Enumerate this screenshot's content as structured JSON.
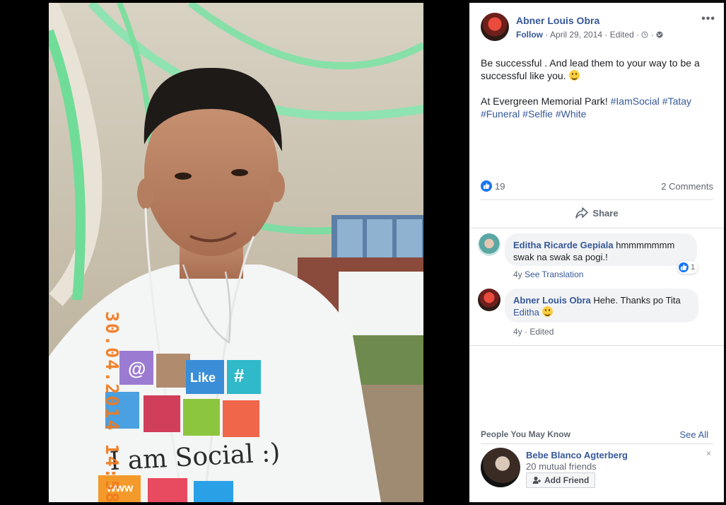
{
  "photo": {
    "date_stamp": "30.04.2014 14:58",
    "shirt_text": "I am Social :)",
    "shirt_like": "Like",
    "shirt_web": "www",
    "shirt_at": "@",
    "shirt_hash": "#"
  },
  "post": {
    "author": "Abner Louis Obra",
    "follow_label": "Follow",
    "separator": "·",
    "date": "April 29, 2014",
    "edited": "Edited",
    "more_label": "•••",
    "text_line1": "Be successful . And lead them to your way to be a successful like you.",
    "location_prefix": "At Evergreen Memorial Park!",
    "hashtags": [
      "#IamSocial",
      "#Tatay",
      "#Funeral",
      "#Selfie",
      "#White"
    ],
    "like_count": "19",
    "comments_count": "2 Comments",
    "share_label": "Share",
    "colors": {
      "link": "#365899",
      "meta": "#606770",
      "like_blue": "#1877f2"
    }
  },
  "comments": [
    {
      "name": "Editha Ricarde Gepiala",
      "text": "hmmmmmmm swak na swak sa pogi.!",
      "age": "4y",
      "action": "See Translation",
      "reactions": "1"
    },
    {
      "name": "Abner Louis Obra",
      "text": "Hehe. Thanks po Tita",
      "mention": "Editha",
      "age": "4y",
      "edited": "Edited"
    }
  ],
  "pymk": {
    "title": "People You May Know",
    "see_all": "See All",
    "person_name": "Bebe Blanco Agterberg",
    "mutual": "20 mutual friends",
    "add_label": "Add Friend",
    "close": "×"
  }
}
